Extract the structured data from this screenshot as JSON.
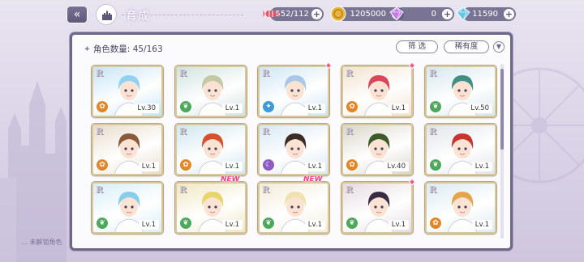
{
  "header": {
    "title": "育成",
    "back_icon": "double-chevron-left-icon",
    "home_icon": "castle-home-icon"
  },
  "currencies": [
    {
      "name": "stamina",
      "icon": "candy-icon",
      "value": "1552/112",
      "color": "#e0566a"
    },
    {
      "name": "gold",
      "icon": "gold-coin-icon",
      "value": "1205000",
      "color": "#e7b53b"
    },
    {
      "name": "paid-gem",
      "icon": "pink-diamond-icon",
      "value": "0",
      "color": "#c77ae6"
    },
    {
      "name": "free-gem",
      "icon": "diamond-icon",
      "value": "11590",
      "color": "#5fc6e8"
    }
  ],
  "panel": {
    "count_label": "角色数量: 45/163",
    "filter_label": "筛 选",
    "rarity_label": "稀有度",
    "sort_icon": "chevron-down-icon"
  },
  "footer_partial": "… 未解锁角色",
  "cards": [
    {
      "rank": "R",
      "level": "Lv.30",
      "element": "fire",
      "hair": "#8fd2f2",
      "bg": "#c7e4f5",
      "new": false,
      "dot": false
    },
    {
      "rank": "R",
      "level": "Lv.1",
      "element": "wind",
      "hair": "#c4c9a4",
      "bg": "#cfe3df",
      "new": false,
      "dot": false
    },
    {
      "rank": "R",
      "level": "Lv.1",
      "element": "water",
      "hair": "#aac6e8",
      "bg": "#cfe6f4",
      "new": false,
      "dot": true
    },
    {
      "rank": "R",
      "level": "Lv.1",
      "element": "fire",
      "hair": "#d9475c",
      "bg": "#f1e3cf",
      "new": false,
      "dot": true
    },
    {
      "rank": "R",
      "level": "Lv.50",
      "element": "wind",
      "hair": "#3f8f86",
      "bg": "#d7e7ee",
      "new": false,
      "dot": false
    },
    {
      "rank": "R",
      "level": "Lv.1",
      "element": "fire",
      "hair": "#8a5a3a",
      "bg": "#e8dccb",
      "new": false,
      "dot": false
    },
    {
      "rank": "R",
      "level": "Lv.1",
      "element": "fire",
      "hair": "#d8512e",
      "bg": "#cfe6ef",
      "new": false,
      "dot": false
    },
    {
      "rank": "R",
      "level": "Lv.1",
      "element": "dark",
      "hair": "#3d2c24",
      "bg": "#d8e8f3",
      "new": false,
      "dot": false
    },
    {
      "rank": "R",
      "level": "Lv.40",
      "element": "fire",
      "hair": "#3f5a2a",
      "bg": "#d9d6c9",
      "new": false,
      "dot": false
    },
    {
      "rank": "R",
      "level": "Lv.1",
      "element": "wind",
      "hair": "#c8352e",
      "bg": "#e0e4ea",
      "new": false,
      "dot": false
    },
    {
      "rank": "R",
      "level": "Lv.1",
      "element": "wind",
      "hair": "#87cdee",
      "bg": "#d7eef8",
      "new": false,
      "dot": false
    },
    {
      "rank": "R",
      "level": "Lv.1",
      "element": "wind",
      "hair": "#e8d56a",
      "bg": "#f0e7c2",
      "new": true,
      "dot": false
    },
    {
      "rank": "R",
      "level": "Lv.1",
      "element": "wind",
      "hair": "#efe2b0",
      "bg": "#f3ecd9",
      "new": true,
      "dot": false
    },
    {
      "rank": "R",
      "level": "Lv.1",
      "element": "wind",
      "hair": "#3a2b45",
      "bg": "#e6dbe2",
      "new": false,
      "dot": true
    },
    {
      "rank": "R",
      "level": "Lv.1",
      "element": "fire",
      "hair": "#e6a54c",
      "bg": "#dbeaf3",
      "new": false,
      "dot": false
    }
  ],
  "element_colors": {
    "fire": "#e2862a",
    "wind": "#4ca85a",
    "water": "#3f9ad8",
    "dark": "#8d5bc4"
  },
  "new_label": "NEW"
}
